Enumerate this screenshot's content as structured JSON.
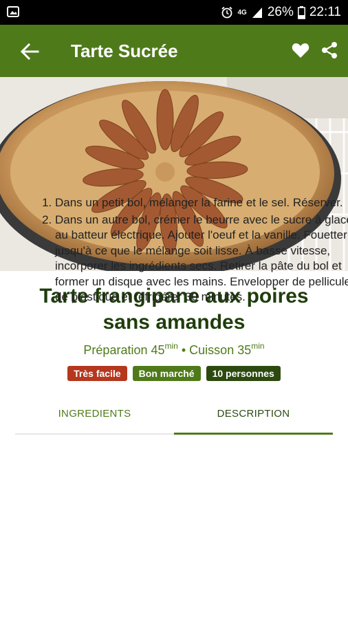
{
  "status_bar": {
    "battery_percent": "26%",
    "time": "22:11",
    "network": "4G"
  },
  "app_bar": {
    "title": "Tarte Sucrée",
    "icons": [
      "back-arrow-icon",
      "heart-icon",
      "share-icon"
    ],
    "color": "#4f7a1a"
  },
  "recipe": {
    "title_line1": "Tarte frangipane aux poires",
    "title_line2": "sans amandes",
    "prep_label": "Préparation 45",
    "prep_unit": "min",
    "separator": " • ",
    "cook_label": "Cuisson 35",
    "cook_unit": "min",
    "badges": [
      {
        "label": "Très facile",
        "color": "#b5371e"
      },
      {
        "label": "Bon marché",
        "color": "#4f7a1a"
      },
      {
        "label": "10 personnes",
        "color": "#2c4a10"
      }
    ]
  },
  "tabs": [
    {
      "label": "INGREDIENTS",
      "active": false
    },
    {
      "label": "DESCRIPTION",
      "active": true
    }
  ],
  "steps": [
    "Dans un petit bol, mélanger la farine et le sel. Réserver.",
    "Dans un autre bol, crémer le beurre avec le sucre à glacer au batteur électrique. Ajouter l'oeuf et la vanille. Fouetter jusqu'à ce que le mélange soit lisse. À basse vitesse, incorporer les ingrédients secs. Retirer la pâte du bol et former un disque avec les mains. Envelopper de pellicule de plastique et réfrigérer 30 minutes."
  ]
}
